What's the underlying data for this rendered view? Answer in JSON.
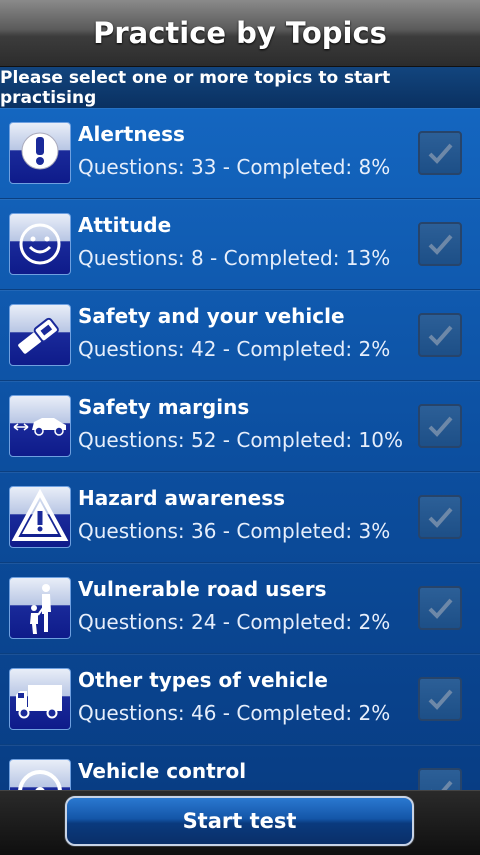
{
  "header": {
    "title": "Practice by Topics"
  },
  "subheader": {
    "text": "Please select one or more topics to start practising"
  },
  "topics": [
    {
      "name": "Alertness",
      "stats": "Questions: 33 - Completed: 8%",
      "icon": "exclamation-icon",
      "checked": false
    },
    {
      "name": "Attitude",
      "stats": "Questions: 8 - Completed: 13%",
      "icon": "smiley-icon",
      "checked": false
    },
    {
      "name": "Safety and your vehicle",
      "stats": "Questions: 42 - Completed: 2%",
      "icon": "seatbelt-icon",
      "checked": false
    },
    {
      "name": "Safety margins",
      "stats": "Questions: 52 - Completed: 10%",
      "icon": "car-distance-icon",
      "checked": false
    },
    {
      "name": "Hazard awareness",
      "stats": "Questions: 36 - Completed: 3%",
      "icon": "warning-triangle-icon",
      "checked": false
    },
    {
      "name": "Vulnerable road users",
      "stats": "Questions: 24 - Completed: 2%",
      "icon": "pedestrians-icon",
      "checked": false
    },
    {
      "name": "Other types of vehicle",
      "stats": "Questions: 46 - Completed: 2%",
      "icon": "truck-icon",
      "checked": false
    },
    {
      "name": "Vehicle control",
      "stats": "",
      "icon": "steering-wheel-icon",
      "checked": false
    }
  ],
  "footer": {
    "start_label": "Start test"
  }
}
